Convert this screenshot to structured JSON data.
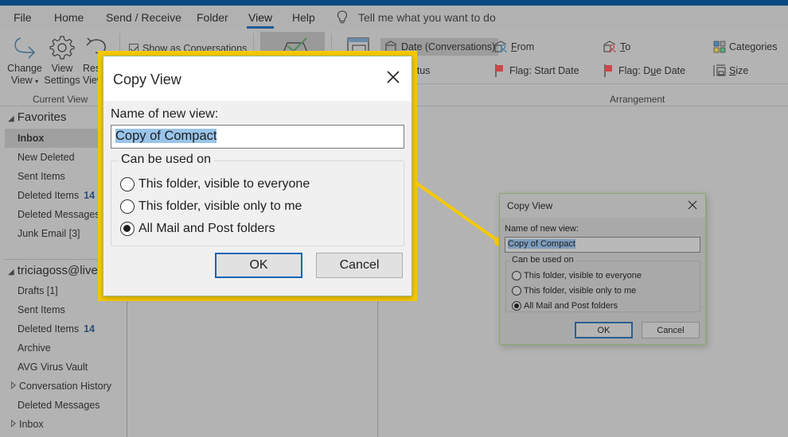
{
  "menubar": {
    "items": [
      "File",
      "Home",
      "Send / Receive",
      "Folder",
      "View",
      "Help"
    ],
    "active": "View",
    "tell_me": "Tell me what you want to do"
  },
  "ribbon": {
    "current_view": {
      "change_view": [
        "Change",
        "View"
      ],
      "view_settings": [
        "View",
        "Settings"
      ],
      "reset_view": [
        "Reset",
        "View"
      ],
      "group_label": "Current View"
    },
    "show_as_conversations": {
      "label": "Show as Conversations",
      "checked": true
    },
    "arrangement": {
      "items": [
        {
          "label": "Date (Conversations)",
          "icon": "date-conversations-icon",
          "selected": true
        },
        {
          "label": "From",
          "icon": "from-icon",
          "underline": "F"
        },
        {
          "label": "To",
          "icon": "to-icon",
          "underline": "T"
        },
        {
          "label": "Categories",
          "icon": "categories-icon",
          "underline": "g"
        },
        {
          "label": "Status",
          "icon": "status-icon"
        },
        {
          "label": "Flag: Start Date",
          "icon": "flag-icon",
          "underline": "g"
        },
        {
          "label": "Flag: Due Date",
          "icon": "flag-icon",
          "underline": "u"
        },
        {
          "label": "Size",
          "icon": "size-icon",
          "underline": "S"
        }
      ],
      "group_label": "Arrangement"
    }
  },
  "sidebar": {
    "favorites": {
      "header": "Favorites",
      "items": [
        {
          "label": "Inbox",
          "selected": true
        },
        {
          "label": "New Deleted"
        },
        {
          "label": "Sent Items"
        },
        {
          "label": "Deleted Items",
          "count": "14"
        },
        {
          "label": "Deleted Messages"
        },
        {
          "label": "Junk Email [3]"
        }
      ]
    },
    "account": {
      "header": "triciagoss@live.",
      "items": [
        {
          "label": "Drafts [1]"
        },
        {
          "label": "Sent Items"
        },
        {
          "label": "Deleted Items",
          "count": "14"
        },
        {
          "label": "Archive"
        },
        {
          "label": "AVG Virus Vault"
        },
        {
          "label": "Conversation History",
          "expandable": true
        },
        {
          "label": "Deleted Messages"
        },
        {
          "label": "Inbox",
          "expandable": true
        }
      ]
    }
  },
  "dialog": {
    "title": "Copy View",
    "name_label": "Name of new view:",
    "name_value": "Copy of Compact",
    "group_label": "Can be used on",
    "options": [
      {
        "label": "This folder, visible to everyone",
        "checked": false
      },
      {
        "label": "This folder, visible only to me",
        "checked": false
      },
      {
        "label": "All Mail and Post folders",
        "checked": true
      }
    ],
    "ok_label": "OK",
    "cancel_label": "Cancel"
  },
  "colors": {
    "highlight": "#f7c900",
    "accent": "#1f5a94",
    "titlebar": "#0a4a82",
    "selection": "#99c4ea",
    "count": "#2c4f78"
  }
}
